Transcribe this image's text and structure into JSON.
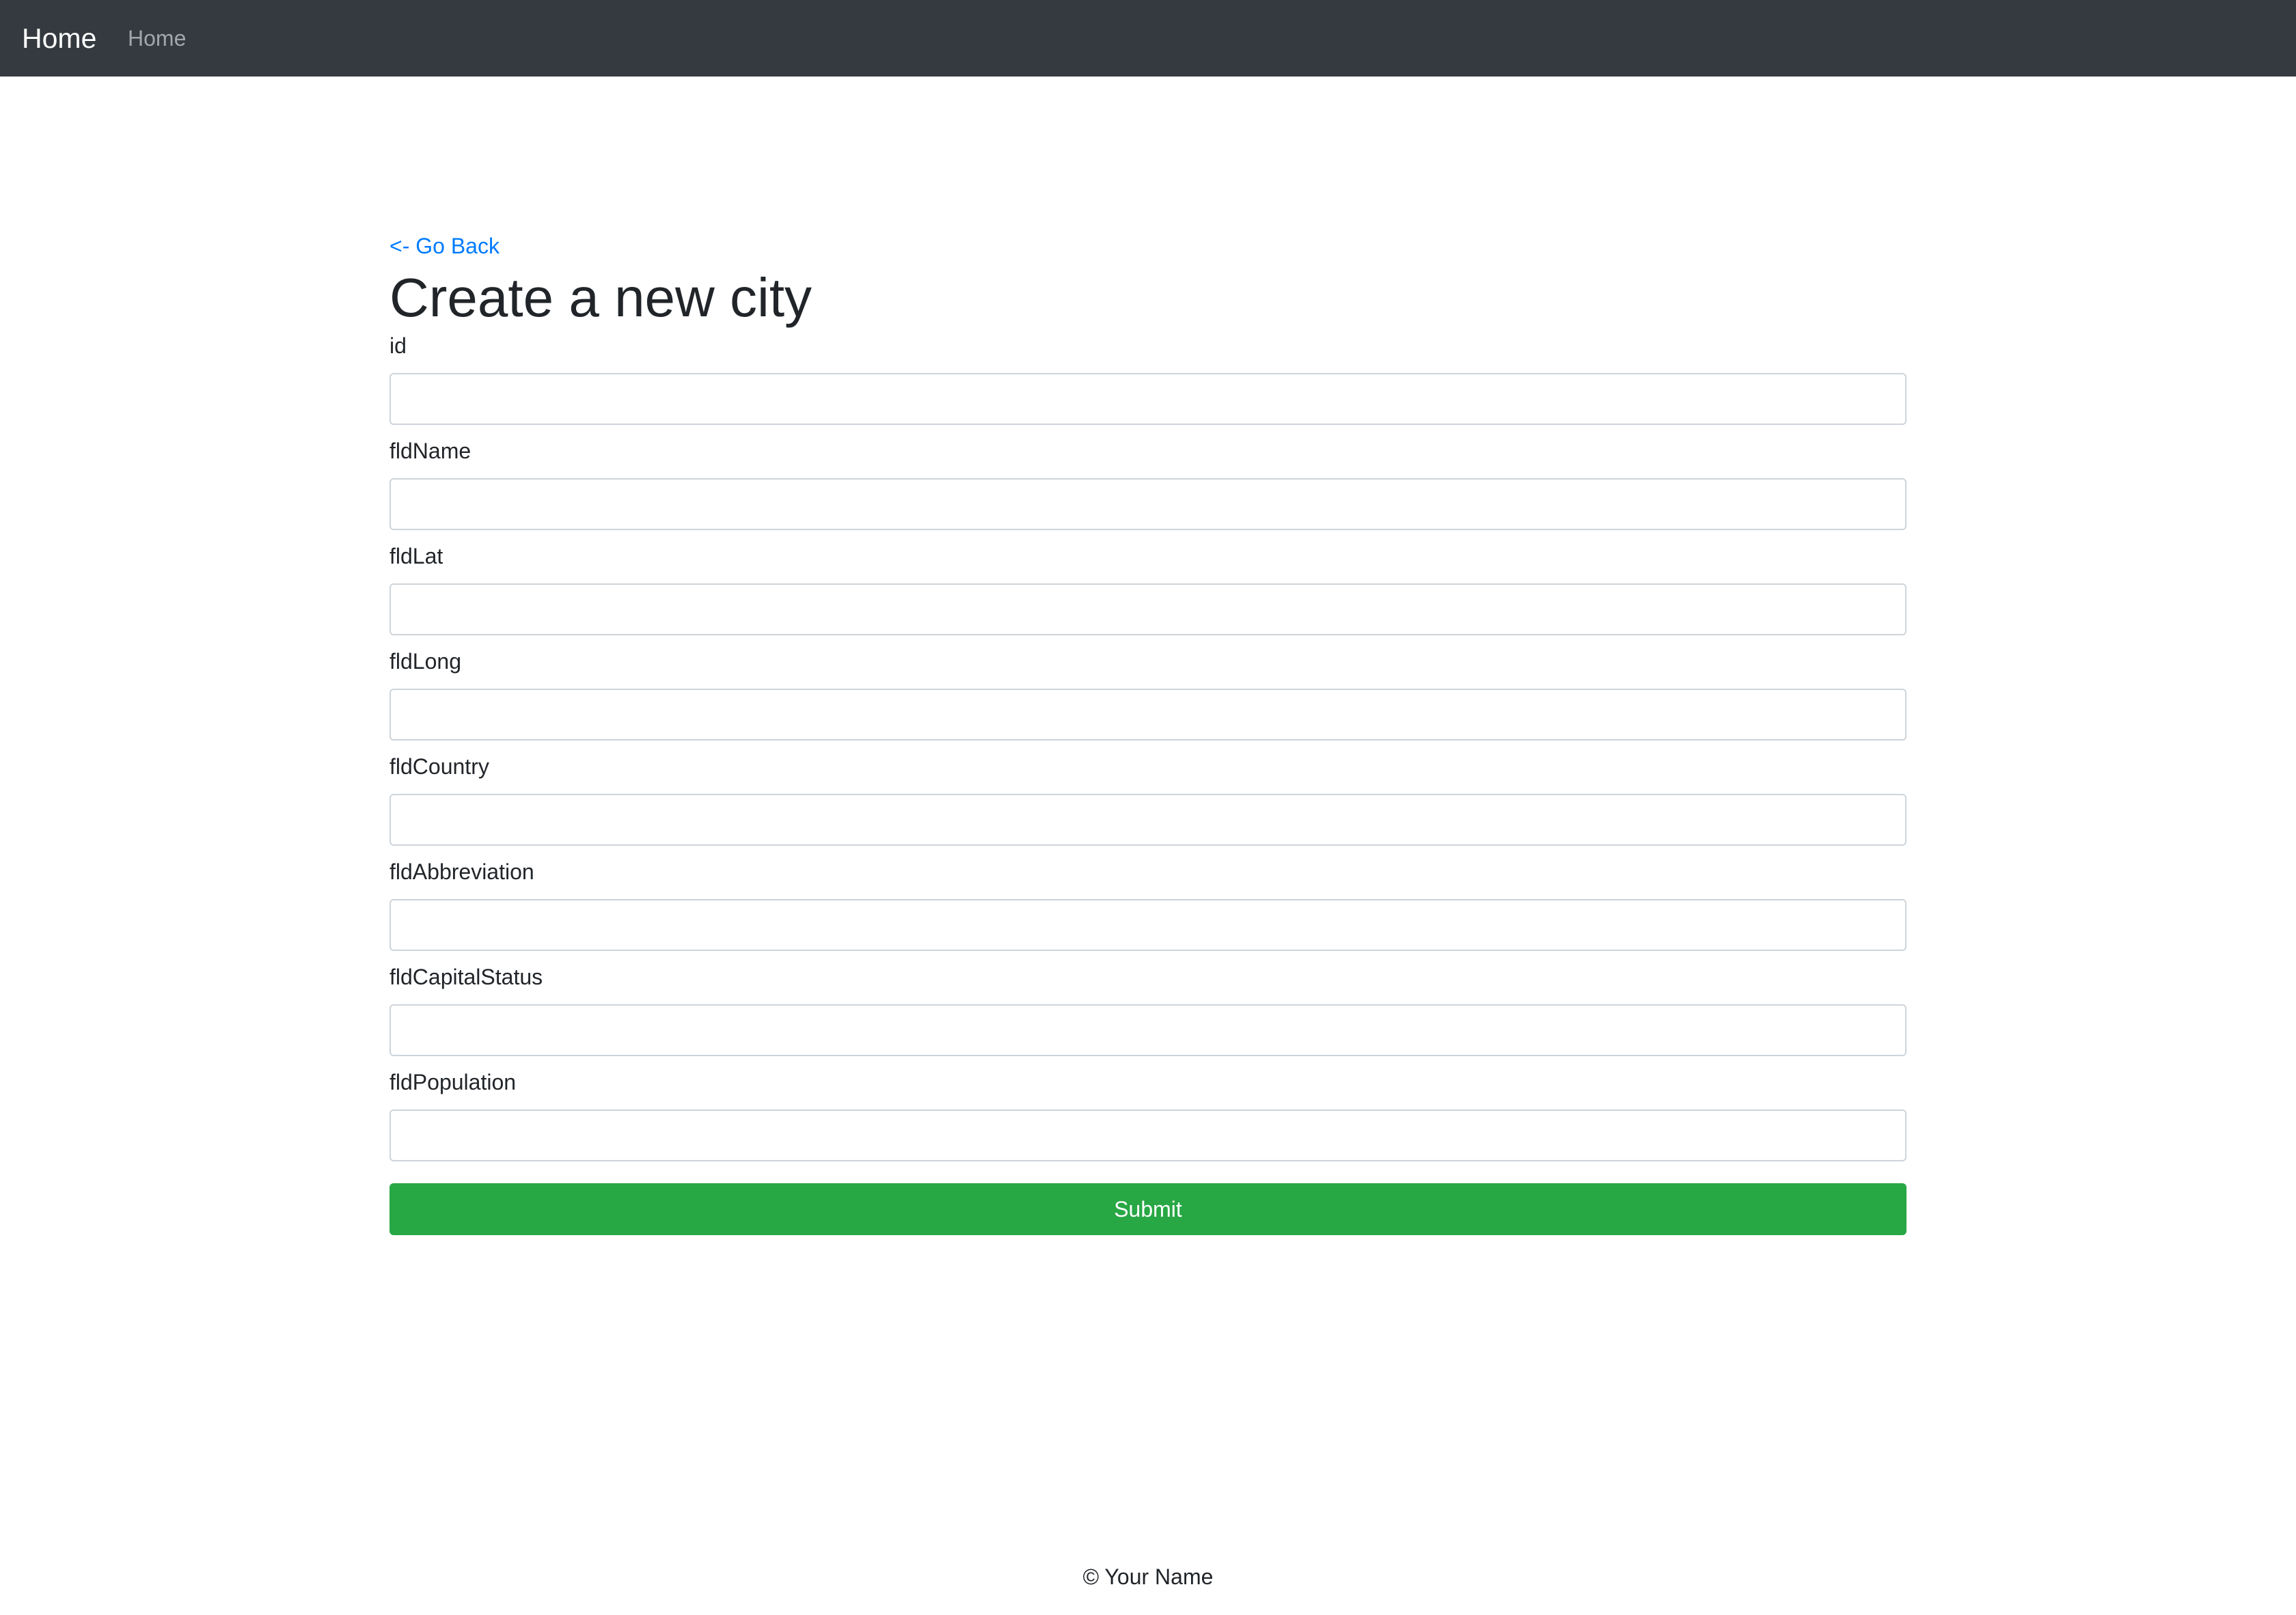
{
  "navbar": {
    "brand": "Home",
    "links": [
      "Home"
    ],
    "background": "#343a40"
  },
  "main": {
    "back_link": "<- Go Back",
    "title": "Create a new city",
    "fields": [
      {
        "label": "id",
        "value": "",
        "placeholder": ""
      },
      {
        "label": "fldName",
        "value": "",
        "placeholder": ""
      },
      {
        "label": "fldLat",
        "value": "",
        "placeholder": ""
      },
      {
        "label": "fldLong",
        "value": "",
        "placeholder": ""
      },
      {
        "label": "fldCountry",
        "value": "",
        "placeholder": ""
      },
      {
        "label": "fldAbbreviation",
        "value": "",
        "placeholder": ""
      },
      {
        "label": "fldCapitalStatus",
        "value": "",
        "placeholder": ""
      },
      {
        "label": "fldPopulation",
        "value": "",
        "placeholder": ""
      }
    ],
    "submit_label": "Submit",
    "submit_color": "#28a745",
    "link_color": "#007bff"
  },
  "footer": {
    "text": "© Your Name"
  }
}
